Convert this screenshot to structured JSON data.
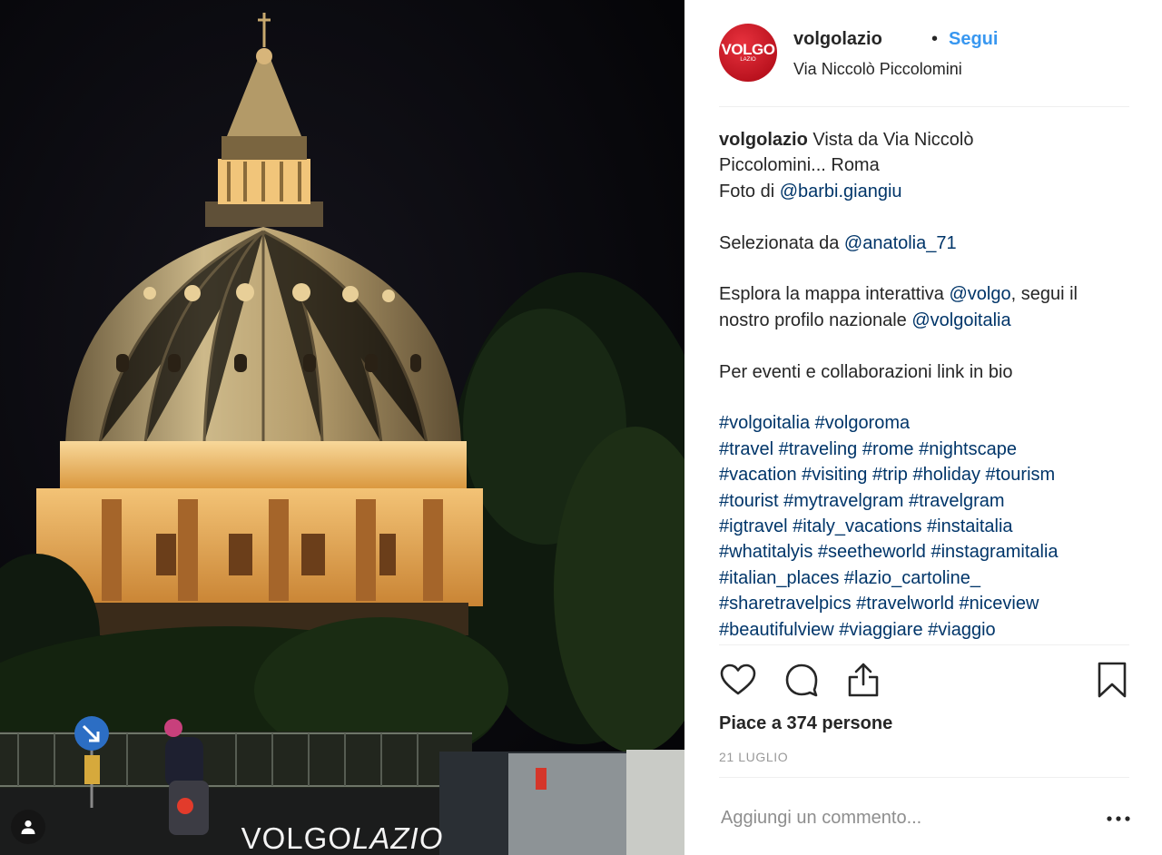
{
  "post": {
    "username": "volgolazio",
    "separator": "•",
    "follow_label": "Segui",
    "location": "Via Niccolò Piccolomini",
    "avatar_text": "VOLGO",
    "avatar_subtext": "LAZIO",
    "photo_watermark_bold": "VOLGO",
    "photo_watermark_italic": "LAZIO"
  },
  "caption": {
    "username": "volgolazio",
    "line1_text": " Vista da Via Niccolò",
    "line2_text": "Piccolomini... Roma",
    "line3_text": "Foto di ",
    "photo_credit": "@barbi.giangiu",
    "line5_text": "Selezionata da ",
    "selected_by": "@anatolia_71",
    "line7_text": "Esplora la mappa interattiva ",
    "mention_volgo": "@volgo",
    "line7_after": ", segui il",
    "line8_text": "nostro profilo nazionale ",
    "mention_volgoitalia": "@volgoitalia",
    "line10_text": "Per eventi e collaborazioni link in bio",
    "hashtag_lines": [
      "#volgoitalia #volgoroma",
      "#travel #traveling #rome #nightscape",
      "#vacation #visiting #trip #holiday #tourism",
      "#tourist #mytravelgram #travelgram",
      "#igtravel #italy_vacations #instaitalia",
      "#whatitalyis #seetheworld #instagramitalia",
      "#italian_places #lazio_cartoline_",
      "#sharetravelpics #travelworld #niceview",
      "#beautifulview #viaggiare #viaggio"
    ]
  },
  "engagement": {
    "likes_text": "Piace a 374 persone",
    "date": "21 LUGLIO"
  },
  "comment": {
    "placeholder": "Aggiungi un commento...",
    "more_label": "•••"
  },
  "icons": {
    "like": "heart-icon",
    "comment": "comment-bubble-icon",
    "share": "share-icon",
    "save": "bookmark-icon",
    "tag": "person-tag-icon"
  }
}
